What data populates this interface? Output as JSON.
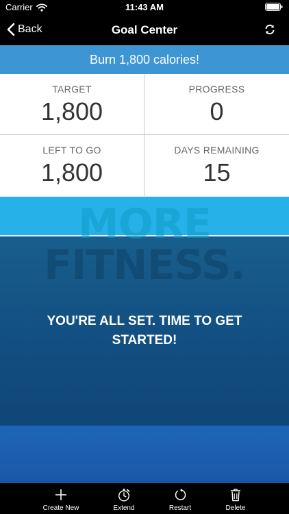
{
  "status_bar": {
    "carrier": "Carrier",
    "time": "11:43 AM"
  },
  "nav": {
    "back_label": "Back",
    "title": "Goal Center"
  },
  "goal_banner": "Burn 1,800 calories!",
  "stats": {
    "target": {
      "label": "TARGET",
      "value": "1,800"
    },
    "progress": {
      "label": "PROGRESS",
      "value": "0"
    },
    "left": {
      "label": "LEFT TO GO",
      "value": "1,800"
    },
    "days": {
      "label": "DAYS REMAINING",
      "value": "15"
    }
  },
  "hero": {
    "background_word_1": "MORE",
    "background_word_2": "FITNESS.",
    "message": "YOU'RE ALL SET. TIME TO GET STARTED!"
  },
  "toolbar": {
    "create": {
      "label": "Create New",
      "icon": "plus-icon"
    },
    "extend": {
      "label": "Extend",
      "icon": "stopwatch-icon"
    },
    "restart": {
      "label": "Restart",
      "icon": "restart-icon"
    },
    "delete": {
      "label": "Delete",
      "icon": "trash-icon"
    }
  },
  "colors": {
    "banner": "#3d95d3",
    "water": "#27b1e9",
    "hero_dark": "#0d3f70"
  }
}
